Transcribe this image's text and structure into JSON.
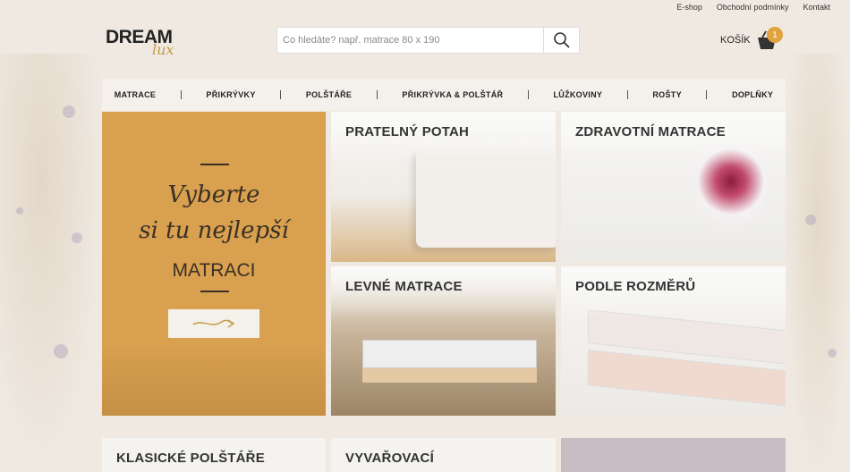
{
  "top_links": [
    "E-shop",
    "Obchodní podmínky",
    "Kontakt"
  ],
  "logo": {
    "main": "DREAM",
    "sub": "lux"
  },
  "search": {
    "placeholder": "Co hledáte? např. matrace 80 x 190"
  },
  "cart": {
    "label": "KOŠÍK",
    "count": "1"
  },
  "nav": [
    "MATRACE",
    "PŘIKRÝVKY",
    "POLŠTÁŘE",
    "PŘIKRÝVKA & POLŠTÁŘ",
    "LŮŽKOVINY",
    "ROŠTY",
    "DOPLŇKY"
  ],
  "promo": {
    "line1": "Vyberte",
    "line2": "si tu nejlepší",
    "strong": "MATRACI"
  },
  "tiles": [
    {
      "title": "PRATELNÝ POTAH"
    },
    {
      "title": "ZDRAVOTNÍ MATRACE"
    },
    {
      "title": "LEVNÉ MATRACE"
    },
    {
      "title": "PODLE ROZMĚRŮ"
    },
    {
      "title": "KLASICKÉ POLŠTÁŘE"
    },
    {
      "title": "VYVAŘOVACÍ"
    }
  ],
  "colors": {
    "accent": "#d8a04f",
    "badge": "#e0a33d",
    "background": "#efe9e1"
  },
  "icons": [
    "search-icon",
    "basket-icon",
    "arrow-right-icon"
  ]
}
